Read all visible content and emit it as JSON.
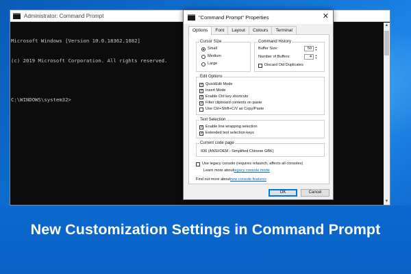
{
  "console": {
    "title": "Administrator: Command Prompt",
    "lines": [
      "Microsoft Windows [Version 10.0.18362.1082]",
      "(c) 2019 Microsoft Corporation. All rights reserved.",
      "",
      "C:\\WINDOWS\\system32>"
    ]
  },
  "dialog": {
    "title": "\"Command Prompt\" Properties",
    "close_glyph": "✕",
    "tabs": [
      {
        "label": "Options",
        "active": true
      },
      {
        "label": "Font",
        "active": false
      },
      {
        "label": "Layout",
        "active": false
      },
      {
        "label": "Colours",
        "active": false
      },
      {
        "label": "Terminal",
        "active": false
      }
    ],
    "cursor_size": {
      "label": "Cursor Size",
      "options": [
        {
          "label": "Small",
          "selected": true
        },
        {
          "label": "Medium",
          "selected": false
        },
        {
          "label": "Large",
          "selected": false
        }
      ]
    },
    "command_history": {
      "label": "Command History",
      "buffer_size_label": "Buffer Size:",
      "buffer_size_value": "50",
      "number_of_buffers_label": "Number of Buffers:",
      "number_of_buffers_value": "4",
      "discard_label": "Discard Old Duplicates",
      "discard_checked": false
    },
    "edit_options": {
      "label": "Edit Options",
      "items": [
        {
          "label": "QuickEdit Mode",
          "checked": true
        },
        {
          "label": "Insert Mode",
          "checked": true
        },
        {
          "label": "Enable Ctrl key shortcuts",
          "checked": true
        },
        {
          "label": "Filter clipboard contents on paste",
          "checked": true
        },
        {
          "label": "Use Ctrl+Shift+C/V as Copy/Paste",
          "checked": false
        }
      ]
    },
    "text_selection": {
      "label": "Text Selection",
      "items": [
        {
          "label": "Enable line wrapping selection",
          "checked": true
        },
        {
          "label": "Extended text selection keys",
          "checked": true
        }
      ]
    },
    "code_page": {
      "label": "Current code page",
      "value": "936   (ANSI/OEM - Simplified Chinese GBK)"
    },
    "legacy": {
      "label": "Use legacy console (requires relaunch, affects all consoles)",
      "checked": false,
      "learn_prefix": "Learn more about ",
      "learn_link": "legacy console mode"
    },
    "features": {
      "prefix": "Find out more about ",
      "link": "new console features"
    },
    "ok_label": "OK",
    "cancel_label": "Cancel"
  },
  "headline": "New Customization Settings in Command Prompt"
}
